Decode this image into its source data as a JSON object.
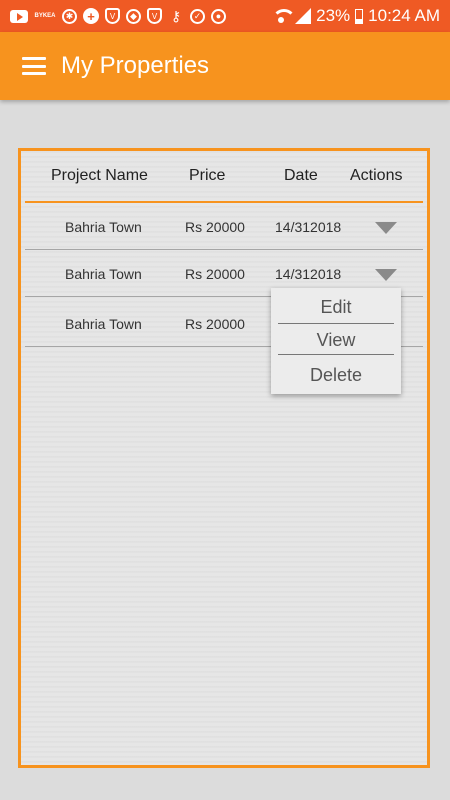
{
  "status_bar": {
    "left_icons": [
      "youtube-icon",
      "app-text-icon",
      "app-badge-icon",
      "plus-cross-icon",
      "shield-v-icon",
      "shield-icon",
      "shield-v-icon",
      "key-icon",
      "check-circle-icon",
      "chrome-icon"
    ],
    "left_icon_text": {
      "app_text": "BYKEA"
    },
    "battery": "23%",
    "time": "10:24 AM"
  },
  "appbar": {
    "title": "My Properties",
    "menu_icon": "hamburger-menu-icon",
    "color": "#f7931e"
  },
  "table": {
    "headers": {
      "project": "Project Name",
      "price": "Price",
      "date": "Date",
      "actions": "Actions"
    },
    "rows": [
      {
        "project": "Bahria Town",
        "price": "Rs 20000",
        "date": "14/312018"
      },
      {
        "project": "Bahria Town",
        "price": "Rs 20000",
        "date": "14/312018"
      },
      {
        "project": "Bahria Town",
        "price": "Rs 20000",
        "date": ""
      }
    ]
  },
  "action_menu": {
    "items": [
      "Edit",
      "View",
      "Delete"
    ]
  },
  "colors": {
    "status_bar": "#ef5a24",
    "accent": "#f7931e",
    "background": "#dcdcdc"
  }
}
